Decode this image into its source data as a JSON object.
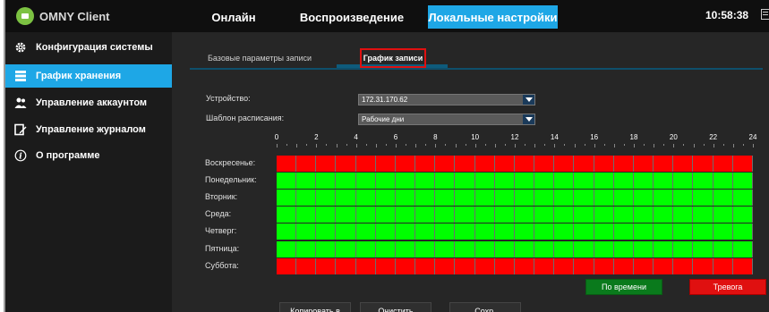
{
  "app": {
    "title": "OMNY Client",
    "clock": "10:58:38",
    "accent_color": "#1ea7e6"
  },
  "top_tabs": [
    {
      "label": "Онлайн"
    },
    {
      "label": "Воспроизведение"
    },
    {
      "label": "Локальные настройки",
      "active": true
    }
  ],
  "sidebar": {
    "items": [
      {
        "label": "Конфигурация системы",
        "icon": "gear-icon"
      },
      {
        "label": "График хранения",
        "icon": "storage-icon",
        "active": true
      },
      {
        "label": "Управление аккаунтом",
        "icon": "users-icon"
      },
      {
        "label": "Управление журналом",
        "icon": "log-edit-icon"
      },
      {
        "label": "О программе",
        "icon": "info-icon"
      }
    ]
  },
  "subtabs": {
    "basic": "Базовые параметры записи",
    "schedule": "График записи"
  },
  "form": {
    "device_label": "Устройство:",
    "device_value": "172.31.170.62",
    "template_label": "Шаблон расписания:",
    "template_value": "Рабочие дни"
  },
  "schedule": {
    "hour_labels": [
      "0",
      "2",
      "4",
      "6",
      "8",
      "10",
      "12",
      "14",
      "16",
      "18",
      "20",
      "22",
      "24"
    ],
    "legend_colors": {
      "time": "#00ff00",
      "alarm": "#ff0000"
    },
    "days": [
      {
        "label": "Воскресенье:",
        "mode": "alarm"
      },
      {
        "label": "Понедельник:",
        "mode": "time"
      },
      {
        "label": "Вторник:",
        "mode": "time"
      },
      {
        "label": "Среда:",
        "mode": "time"
      },
      {
        "label": "Четверг:",
        "mode": "time"
      },
      {
        "label": "Пятница:",
        "mode": "time"
      },
      {
        "label": "Суббота:",
        "mode": "alarm"
      }
    ]
  },
  "buttons": {
    "time": "По времени",
    "alarm": "Тревога",
    "copy": "Копировать в",
    "clear": "Очистить",
    "save": "Сохр."
  }
}
